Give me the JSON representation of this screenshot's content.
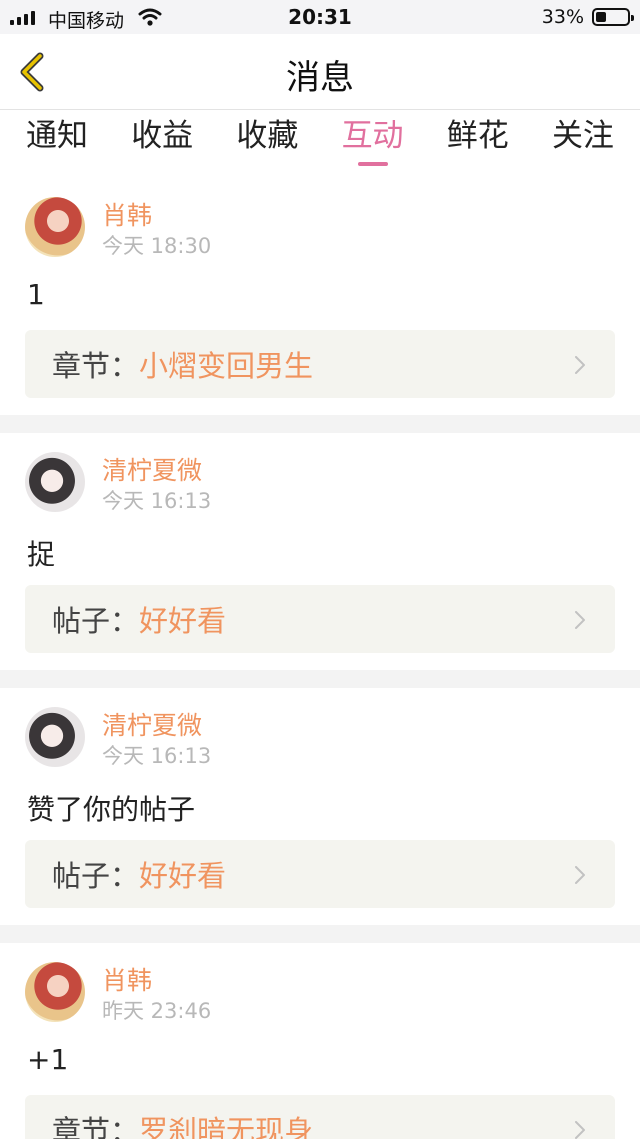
{
  "status_bar": {
    "carrier": "中国移动",
    "time": "20:31",
    "battery_percent": "33%",
    "battery_level": 0.33,
    "icons": [
      "signal-icon",
      "wifi-icon",
      "battery-icon"
    ]
  },
  "nav": {
    "title": "消息",
    "back_icon": "chevron-left-icon",
    "accent_color": "#e8c300"
  },
  "tabs": [
    {
      "label": "通知",
      "active": false
    },
    {
      "label": "收益",
      "active": false
    },
    {
      "label": "收藏",
      "active": false
    },
    {
      "label": "互动",
      "active": true
    },
    {
      "label": "鲜花",
      "active": false
    },
    {
      "label": "关注",
      "active": false
    }
  ],
  "colors": {
    "active_tab": "#e1709e",
    "name_and_link": "#f0945f",
    "timestamp": "#b8b8b8"
  },
  "messages": [
    {
      "user": "肖韩",
      "time": "今天 18:30",
      "content": "1",
      "ref_prefix": "章节：",
      "ref_title": "小熠变回男生"
    },
    {
      "user": "清柠夏微",
      "time": "今天 16:13",
      "content": "捉",
      "ref_prefix": "帖子：",
      "ref_title": "好好看"
    },
    {
      "user": "清柠夏微",
      "time": "今天 16:13",
      "content": "赞了你的帖子",
      "ref_prefix": "帖子：",
      "ref_title": "好好看"
    },
    {
      "user": "肖韩",
      "time": "昨天 23:46",
      "content": "+1",
      "ref_prefix": "章节：",
      "ref_title": "罗刹暗无现身"
    }
  ]
}
